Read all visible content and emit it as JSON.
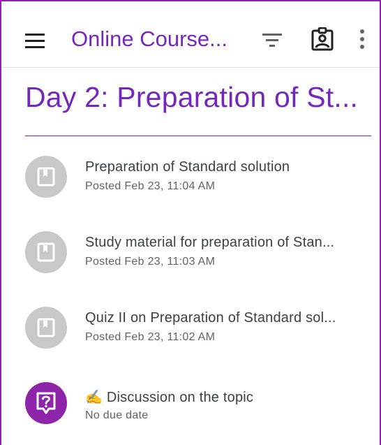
{
  "app_bar": {
    "title": "Online Course...",
    "menu_icon": "menu-icon",
    "filter_icon": "filter-icon",
    "classwork_icon": "assignment-ind-icon",
    "more_icon": "more-vert-icon"
  },
  "topic": {
    "title": "Day 2: Preparation of St..."
  },
  "colors": {
    "accent": "#7627bb",
    "avatar_grey": "#c8c8c8",
    "avatar_purple": "#8e24aa"
  },
  "items": [
    {
      "title": "Preparation of Standard solution",
      "subtitle": "Posted Feb 23, 11:04 AM",
      "icon": "material-icon"
    },
    {
      "title": "Study material for preparation of Stan...",
      "subtitle": "Posted Feb 23, 11:03 AM",
      "icon": "material-icon"
    },
    {
      "title": "Quiz II on Preparation of Standard sol...",
      "subtitle": "Posted Feb 23, 11:02 AM",
      "icon": "material-icon"
    },
    {
      "title": "✍️ Discussion on the topic",
      "subtitle": "No due date",
      "icon": "question-icon"
    }
  ]
}
